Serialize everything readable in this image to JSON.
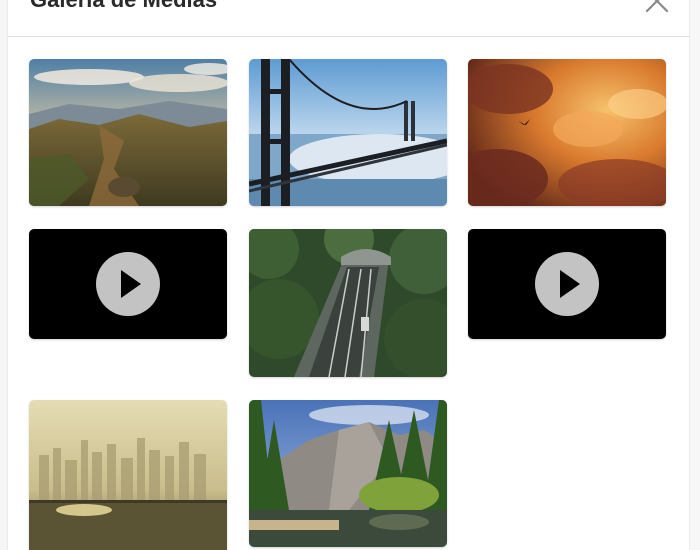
{
  "dialog": {
    "title": "Galeria de Medias",
    "close_icon": "close-icon"
  },
  "gallery": {
    "items": [
      {
        "type": "image",
        "subject": "mountain-landscape"
      },
      {
        "type": "image",
        "subject": "golden-gate-bridge-fog"
      },
      {
        "type": "image",
        "subject": "orange-clouds-bird"
      },
      {
        "type": "video",
        "icon": "play-icon"
      },
      {
        "type": "image",
        "subject": "forest-tunnel-aerial"
      },
      {
        "type": "video",
        "icon": "play-icon"
      },
      {
        "type": "image",
        "subject": "hazy-city-skyline"
      },
      {
        "type": "image",
        "subject": "yosemite-valley"
      }
    ]
  },
  "colors": {
    "video_background": "#000000",
    "play_button": "#c3c3c3",
    "divider": "#dedede"
  }
}
